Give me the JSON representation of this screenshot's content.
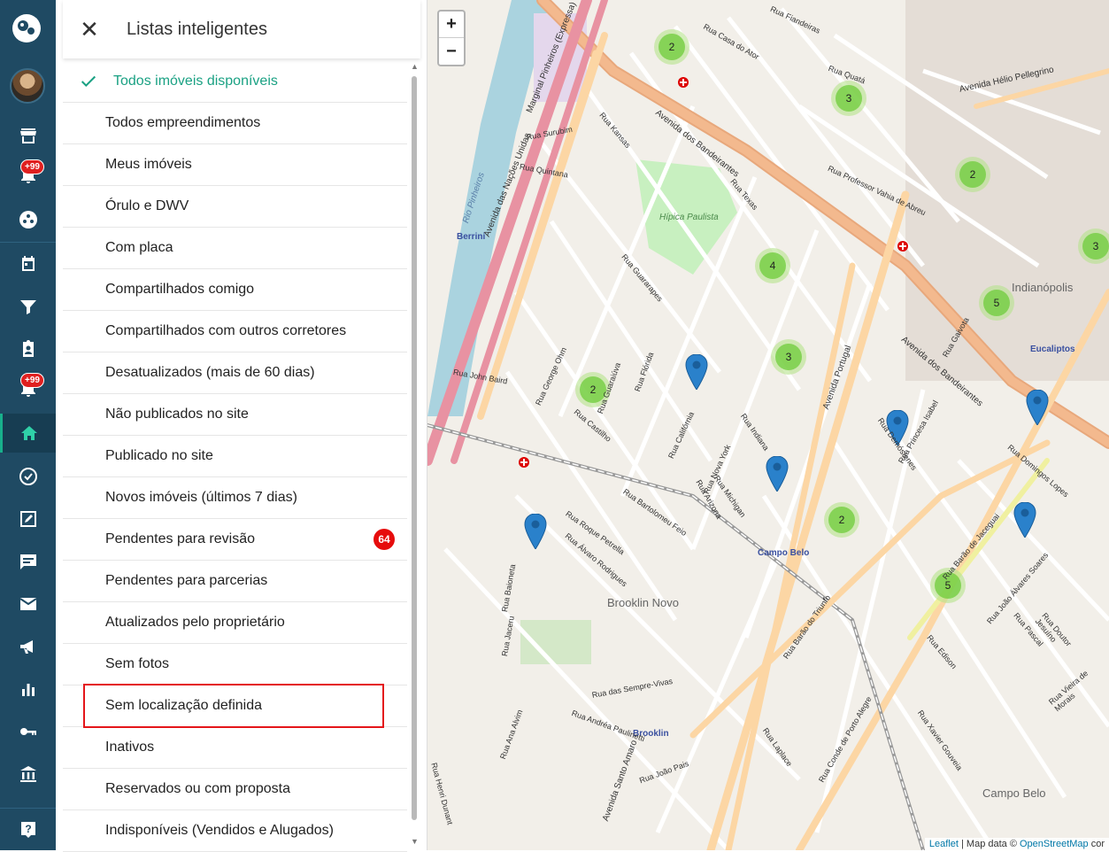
{
  "panel": {
    "title": "Listas inteligentes",
    "items": [
      {
        "label": "Todos imóveis disponíveis",
        "checked": true
      },
      {
        "label": "Todos empreendimentos"
      },
      {
        "label": "Meus imóveis"
      },
      {
        "label": "Órulo e DWV"
      },
      {
        "label": "Com placa"
      },
      {
        "label": "Compartilhados comigo"
      },
      {
        "label": "Compartilhados com outros corretores"
      },
      {
        "label": "Desatualizados (mais de 60 dias)"
      },
      {
        "label": "Não publicados no site"
      },
      {
        "label": "Publicado no site"
      },
      {
        "label": "Novos imóveis (últimos 7 dias)"
      },
      {
        "label": "Pendentes para revisão",
        "badge": "64"
      },
      {
        "label": "Pendentes para parcerias"
      },
      {
        "label": "Atualizados pelo proprietário"
      },
      {
        "label": "Sem fotos"
      },
      {
        "label": "Sem localização definida",
        "highlighted": true
      },
      {
        "label": "Inativos"
      },
      {
        "label": "Reservados ou com proposta"
      },
      {
        "label": "Indisponíveis (Vendidos e Alugados)"
      }
    ]
  },
  "rail": {
    "badge_notifications": "+99",
    "badge_leads": "+99",
    "active_item": "home"
  },
  "map": {
    "zoom_in": "+",
    "zoom_out": "−",
    "clusters": [
      "2",
      "3",
      "2",
      "4",
      "3",
      "3",
      "5",
      "2",
      "2",
      "5"
    ],
    "labels": {
      "brooklin_novo": "Brooklin Novo",
      "indianopolis": "Indianópolis",
      "campo_belo": "Campo Belo",
      "berrini": "Berrini",
      "eucaliptos": "Eucaliptos",
      "brooklin": "Brooklin",
      "campo_belo_station": "Campo Belo",
      "hipica_paulista": "Hípica Paulista",
      "av_bandeirantes": "Avenida dos Bandeirantes",
      "av_bandeirantes_2": "Avenida dos Bandeirantes",
      "av_portugal": "Avenida Portugal",
      "av_santo_amaro": "Avenida Santo Amaro",
      "av_nacoes_unidas": "Avenida das Nações Unidas",
      "marginal_pinheiros": "Marginal Pinheiros (Expressa)",
      "rio_pinheiros": "Rio Pinheiros",
      "av_helio_pellegrino": "Avenida Hélio Pellegrino",
      "rua_guaraiuva": "Rua Guaraiúva",
      "rua_california": "Rua Califórnia",
      "rua_texas": "Rua Texas",
      "rua_nova_york": "Rua Nova York",
      "rua_barao_triunfo": "Rua Barão do Triunfo",
      "rua_demostenes": "Rua Demóstenes",
      "rua_roque_petrella": "Rua Roque Petrella",
      "rua_joao_alvares_soares": "Rua João Álvares Soares",
      "rua_vieira_morais": "Rua Vieira de Morais",
      "rua_princesa_isabel": "Rua Princesa Isabel",
      "rua_gaivota": "Rua Gaivota",
      "rua_professor_vahia": "Rua Professor Vahia de Abreu",
      "rua_conde_porto_alegre": "Rua Conde de Porto Alegre",
      "rua_florida": "Rua Flórida",
      "rua_michigan": "Rua Michigan",
      "rua_bartolomeu_feio": "Rua Bartolomeu Feio",
      "rua_edison": "Rua Edison",
      "rua_fiandeiras": "Rua Fiandeiras",
      "rua_casa_ator": "Rua Casa do Ator",
      "rua_guararapes": "Rua Guararapes",
      "rua_quata": "Rua Quatá",
      "rua_arizona": "Rua Arizona",
      "rua_indiana": "Rua Indiana",
      "rua_kansas": "Rua Kansas",
      "rua_joao_pais": "Rua João Pais",
      "rua_jaceru": "Rua Jaceru",
      "rua_baioneta": "Rua Baioneta",
      "rua_alvaro_rodrigues": "Rua Álvaro Rodrigues",
      "rua_das_sempre_vivas": "Rua das Sempre-Vivas",
      "rua_andrea_paulinetti": "Rua Andréa Paulinetti",
      "rua_anna_alvim": "Rua Ana Alvim",
      "rua_henri_dunant": "Rua Henri Dunant",
      "rua_laplace": "Rua Laplace",
      "rua_xavier_gouveia": "Rua Xavier Gouveia",
      "rua_pascal": "Rua Pascal",
      "rua_doutor_jesuino": "Rua Doutor Jesuíno",
      "rua_domingos_lopes": "Rua Domingos Lopes",
      "rua_barao_jaceguai": "Rua Barão de Jaceguai",
      "rua_george_ohm": "Rua George Ohm",
      "rua_john_baird": "Rua John Baird",
      "rua_surubim": "Rua Surubim",
      "rua_quintana": "Rua Quintana",
      "rua_castilho": "Rua Castilho"
    },
    "attribution_leaflet": "Leaflet",
    "attribution_text": " | Map data © ",
    "attribution_osm": "OpenStreetMap",
    "attribution_suffix": " cor"
  }
}
